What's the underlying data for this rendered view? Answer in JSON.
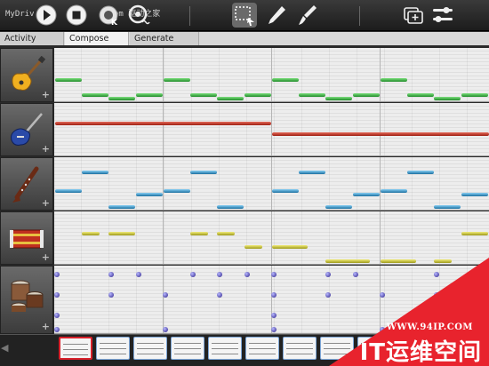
{
  "toolbar": {
    "watermark": "MyDriv",
    "watermark_suffix": "com 驱动之家",
    "buttons": [
      "play-icon",
      "stop-icon",
      "record-icon",
      "metronome-icon",
      "marquee-select-icon",
      "pencil-icon",
      "brush-icon",
      "add-layer-icon",
      "mixer-sliders-icon"
    ],
    "accent": "#ffffff"
  },
  "tabs": [
    {
      "label": "Activity",
      "active": false
    },
    {
      "label": "Compose",
      "active": true
    },
    {
      "label": "Generate",
      "active": false
    }
  ],
  "tracks": [
    {
      "instrument": "electric-guitar-icon",
      "plus": "+",
      "color": "#2a9a34"
    },
    {
      "instrument": "bass-guitar-icon",
      "plus": "+",
      "color": "#b8281b"
    },
    {
      "instrument": "clarinet-icon",
      "plus": "+",
      "color": "#2a86c0"
    },
    {
      "instrument": "accordion-icon",
      "plus": "+",
      "color": "#b8b21e"
    },
    {
      "instrument": "drums-icon",
      "plus": "+",
      "color": "#2a1f8a"
    }
  ],
  "patterns": {
    "count": 9,
    "selected": 1
  },
  "scroll_left": "◀",
  "brand": {
    "url": "WWW.94IP.COM",
    "text": "IT运维空间",
    "color": "#e8232d"
  }
}
